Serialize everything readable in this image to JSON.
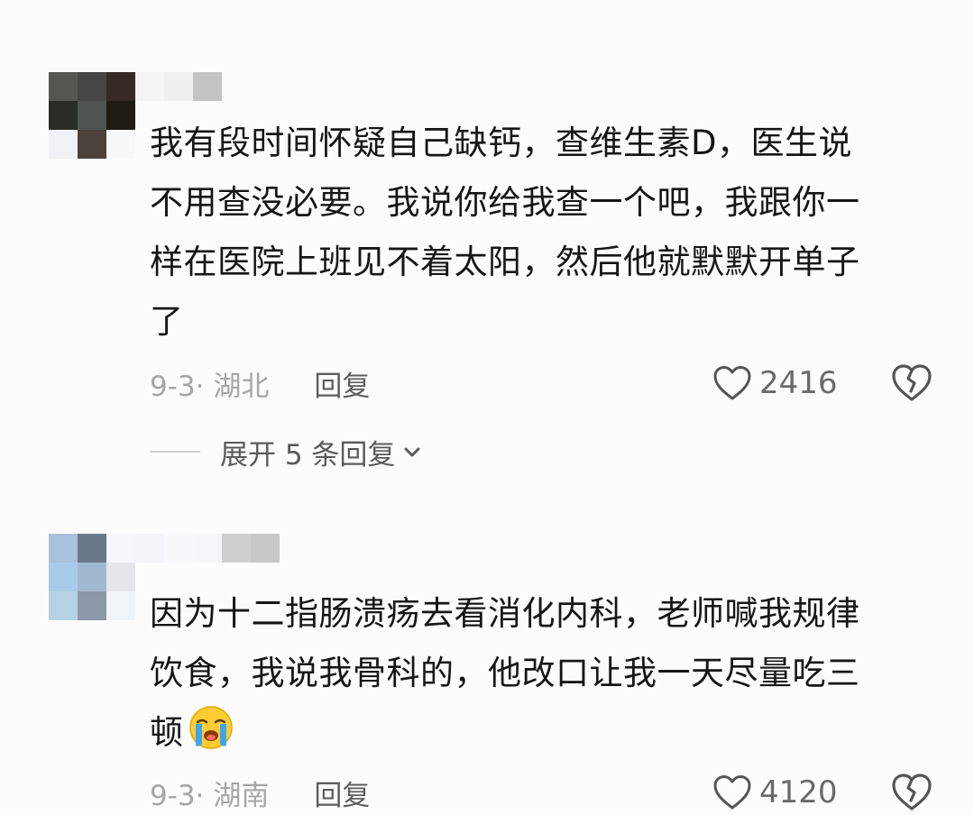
{
  "colors": {
    "background": "#fcfcfc",
    "text": "#161616",
    "meta": "#a6a6a6",
    "reply": "#5d5d5d"
  },
  "comments": [
    {
      "avatar_pixels": [
        "#565651",
        "#444742",
        "#352a26",
        "#2b2b25",
        "#505450",
        "#1f1a14",
        "#f1f2f6",
        "#4a413a",
        "#f8f8f8"
      ],
      "username_pixels": [
        "#f4f4f4",
        "#f0f0f0",
        "#c4c4c4"
      ],
      "lines": [
        "我有段时间怀疑自己缺钙，查维生素D，医生说",
        "不用查没必要。我说你给我查一个吧，我跟你一",
        "样在医院上班见不着太阳，然后他就默默开单子",
        "了"
      ],
      "date_location": "9-3· 湖北",
      "reply_label": "回复",
      "like_icon": "heart-outline-icon",
      "likes": "2416",
      "dislike_icon": "broken-heart-icon",
      "expand_label": "展开 5 条回复",
      "expand_icon": "chevron-down-icon"
    },
    {
      "avatar_pixels": [
        "#a9c1dc",
        "#6a7a8c",
        "#f4f4fb",
        "#a7cbe8",
        "#a1b9ce",
        "#e6e6ea",
        "#b5d3e4",
        "#8d98a8",
        "#eef4f8"
      ],
      "username_pixels": [
        "#f6f6fc",
        "#f4f4fa",
        "#f8f8fb",
        "#f6f6f8",
        "#cfcfcf",
        "#c8c8c8"
      ],
      "lines": [
        "因为十二指肠溃疡去看消化内科，老师喊我规律",
        "饮食，我说我骨科的，他改口让我一天尽量吃三",
        "顿"
      ],
      "emoji": "crying-face-emoji-icon",
      "date_location": "9-3· 湖南",
      "reply_label": "回复",
      "like_icon": "heart-outline-icon",
      "likes": "4120",
      "dislike_icon": "broken-heart-icon"
    }
  ]
}
